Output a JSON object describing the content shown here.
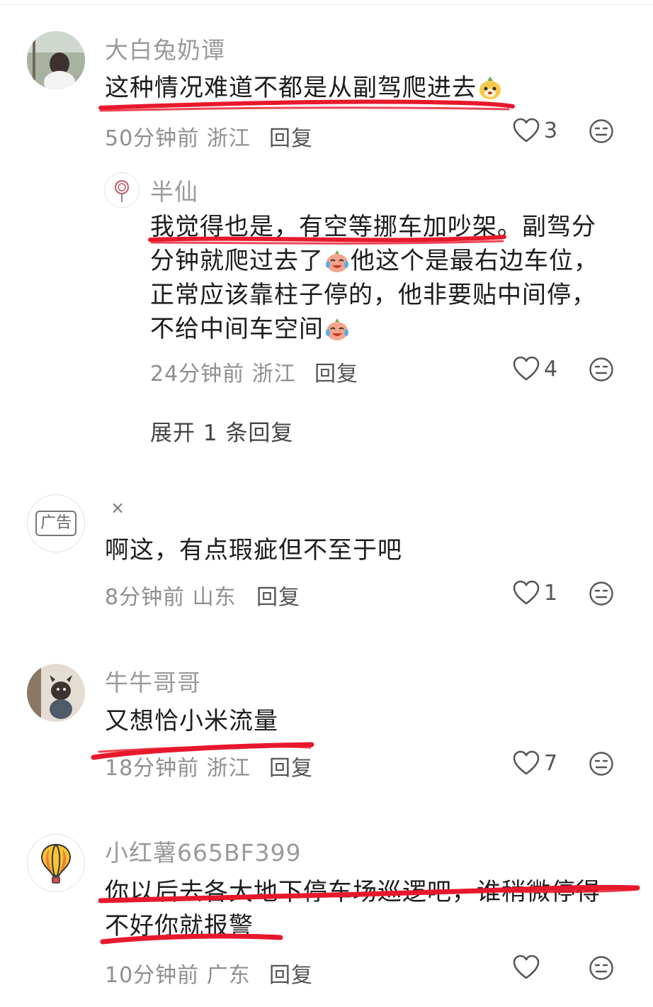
{
  "comments": [
    {
      "username": "大白兔奶谭",
      "text": "这种情况难道不都是从副驾爬进去",
      "time": "50分钟前",
      "location": "浙江",
      "reply_label": "回复",
      "likes": "3"
    },
    {
      "username": "半仙",
      "text_lines": [
        "我觉得也是，有空等挪车加吵架。副驾分",
        "分钟就爬过去了",
        "他这个是最右边车位，",
        "正常应该靠柱子停的，他非要贴中间停，",
        "不给中间车空间"
      ],
      "time": "24分钟前",
      "location": "浙江",
      "reply_label": "回复",
      "likes": "4",
      "expand_label": "展开 1 条回复"
    },
    {
      "ad_badge": "广告",
      "close_label": "×",
      "text": "啊这，有点瑕疵但不至于吧",
      "time": "8分钟前",
      "location": "山东",
      "reply_label": "回复",
      "likes": "1"
    },
    {
      "username": "牛牛哥哥",
      "text": "又想恰小米流量",
      "time": "18分钟前",
      "location": "浙江",
      "reply_label": "回复",
      "likes": "7"
    },
    {
      "username": "小红薯665BF399",
      "text_lines": [
        "你以后去各大地下停车场巡逻吧，谁稍微停得",
        "不好你就报警"
      ],
      "time": "10分钟前",
      "location": "广东",
      "reply_label": "回复",
      "likes": ""
    }
  ],
  "icons": {
    "like": "heart-outline-icon",
    "dislike": "meh-face-icon",
    "close": "close-icon"
  },
  "colors": {
    "annotation_red": "#e8182c",
    "username_gray": "#9a9a9a"
  }
}
